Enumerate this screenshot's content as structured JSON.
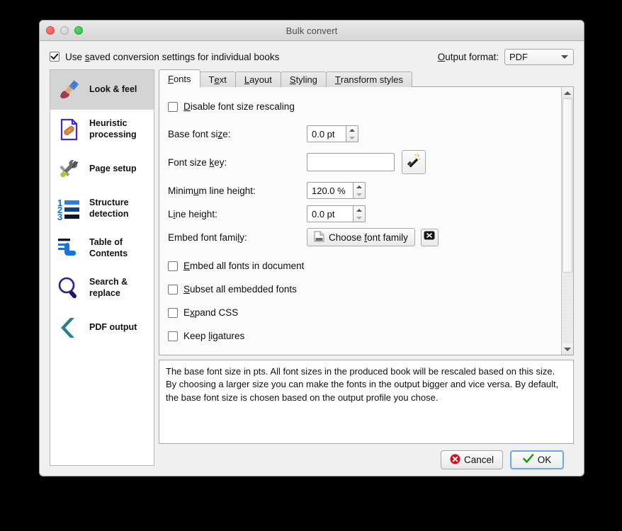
{
  "window": {
    "title": "Bulk convert",
    "controls": {
      "close": "close",
      "minimize": "minimize",
      "zoom": "zoom"
    }
  },
  "header": {
    "use_saved_settings": {
      "label_before": "Use ",
      "label_accel": "s",
      "label_after": "aved conversion settings for individual books",
      "checked": true
    },
    "output_format_label_accel": "O",
    "output_format_label_rest": "utput format:",
    "output_format_value": "PDF",
    "output_format_options": [
      "PDF"
    ]
  },
  "sidebar": {
    "items": [
      {
        "label": "Look & feel",
        "icon": "paintbrush-icon",
        "selected": true
      },
      {
        "label": "Heuristic processing",
        "icon": "document-bandaid-icon",
        "selected": false
      },
      {
        "label": "Page setup",
        "icon": "wrench-screwdriver-icon",
        "selected": false
      },
      {
        "label": "Structure detection",
        "icon": "numbered-list-icon",
        "selected": false
      },
      {
        "label": "Table of Contents",
        "icon": "toc-hand-icon",
        "selected": false
      },
      {
        "label": "Search & replace",
        "icon": "magnifier-icon",
        "selected": false
      },
      {
        "label": "PDF output",
        "icon": "chevron-left-icon",
        "selected": false
      }
    ]
  },
  "tabs": [
    {
      "label": "Fonts",
      "accel": "F",
      "rest": "onts",
      "active": true
    },
    {
      "label": "Text",
      "accel": "e",
      "pre": "T",
      "rest": "xt",
      "active": false
    },
    {
      "label": "Layout",
      "accel": "L",
      "rest": "ayout",
      "active": false
    },
    {
      "label": "Styling",
      "accel": "S",
      "rest": "tyling",
      "active": false
    },
    {
      "label": "Transform styles",
      "accel": "T",
      "rest": "ransform styles",
      "active": false
    }
  ],
  "fonts_tab": {
    "disable_rescaling": {
      "pre": "",
      "accel": "D",
      "rest": "isable font size rescaling",
      "checked": false
    },
    "base_font_size": {
      "label_pre": "Base font si",
      "label_accel": "z",
      "label_rest": "e:",
      "value": "0.0 pt"
    },
    "font_size_key": {
      "label_pre": "Font size ",
      "label_accel": "k",
      "label_rest": "ey:",
      "value": "",
      "placeholder": ""
    },
    "wand_button": "magic-wand",
    "minimum_line_height": {
      "label_pre": "Minim",
      "label_accel": "u",
      "label_rest": "m line height:",
      "value": "120.0 %"
    },
    "line_height": {
      "label_pre": "L",
      "label_accel": "i",
      "label_rest": "ne height:",
      "value": "0.0 pt"
    },
    "embed_font_family": {
      "label_pre": "Embed font fami",
      "label_accel": "l",
      "label_rest": "y:",
      "button_pre": "Choose ",
      "button_accel": "f",
      "button_rest": "ont family",
      "clear_button": "clear"
    },
    "checkboxes": [
      {
        "pre": "",
        "accel": "E",
        "rest": "mbed all fonts in document",
        "checked": false
      },
      {
        "pre": "",
        "accel": "S",
        "rest": "ubset all embedded fonts",
        "checked": false
      },
      {
        "pre": "E",
        "accel": "x",
        "rest": "pand CSS",
        "checked": false
      },
      {
        "pre": "Keep ",
        "accel": "l",
        "rest": "igatures",
        "checked": false
      }
    ]
  },
  "help_text": "The base font size in pts. All font sizes in the produced book will be rescaled based on this size. By choosing a larger size you can make the fonts in the output bigger and vice versa. By default, the base font size is chosen based on the output profile you chose.",
  "footer": {
    "cancel_label": "Cancel",
    "ok_label": "OK"
  },
  "colors": {
    "selected_row": "#d4d4d4",
    "window_bg": "#f0f0f0",
    "panel_bg": "#fbfbfb",
    "default_button_border": "#6aa8ef",
    "cancel_icon": "#c4171b",
    "ok_icon": "#18a018"
  }
}
